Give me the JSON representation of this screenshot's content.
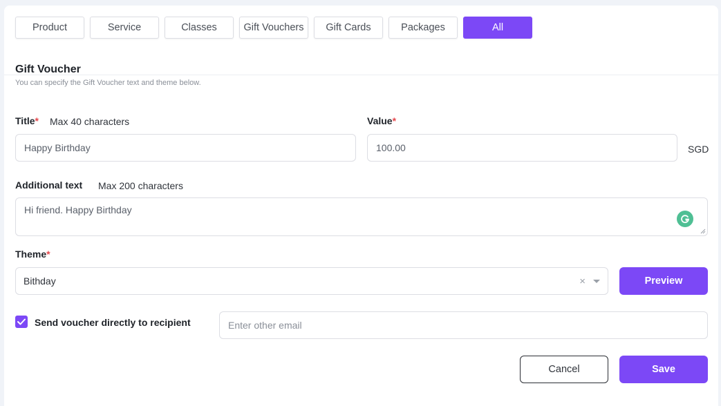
{
  "tabs": [
    {
      "label": "Product",
      "active": false
    },
    {
      "label": "Service",
      "active": false
    },
    {
      "label": "Classes",
      "active": false
    },
    {
      "label": "Gift Vouchers",
      "active": false
    },
    {
      "label": "Gift Cards",
      "active": false
    },
    {
      "label": "Packages",
      "active": false
    },
    {
      "label": "All",
      "active": true
    }
  ],
  "section": {
    "title": "Gift Voucher",
    "subtitle": "You can specify the Gift Voucher text and theme below."
  },
  "form": {
    "title": {
      "label": "Title",
      "required_mark": "*",
      "hint": "Max 40 characters",
      "value": "Happy Birthday"
    },
    "value": {
      "label": "Value",
      "required_mark": "*",
      "value": "100.00",
      "currency": "SGD"
    },
    "additional_text": {
      "label": "Additional text",
      "hint": "Max 200 characters",
      "value": "Hi friend. Happy Birthday",
      "grammarly_icon": "grammarly-icon"
    },
    "theme": {
      "label": "Theme",
      "required_mark": "*",
      "selected": "Bithday",
      "clear_glyph": "×"
    },
    "preview_label": "Preview",
    "send_direct": {
      "label": "Send voucher directly to recipient",
      "checked": true
    },
    "email": {
      "placeholder": "Enter other email",
      "value": ""
    },
    "cancel_label": "Cancel",
    "save_label": "Save"
  },
  "colors": {
    "accent": "#7c48f6",
    "required": "#e5484d",
    "grammarly": "#4fbf94"
  }
}
